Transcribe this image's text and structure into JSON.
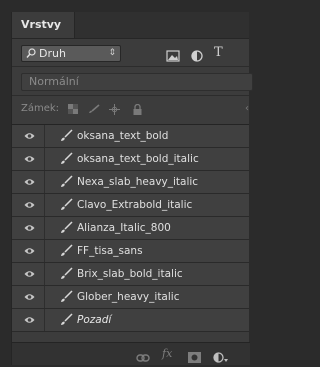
{
  "panel": {
    "tab_title": "Vrstvy",
    "filter": {
      "kind_label": "Druh",
      "icons": [
        "image-filter-icon",
        "adjustment-filter-icon",
        "type-filter-icon"
      ],
      "type_glyph": "T"
    },
    "blend_mode": "Normální",
    "lock_label": "Zámek:",
    "lock_icons": [
      "lock-transparency-icon",
      "lock-brush-icon",
      "lock-move-icon",
      "lock-all-icon"
    ],
    "layers": [
      {
        "name": "oksana_text_bold",
        "icon": "brush-icon"
      },
      {
        "name": "oksana_text_bold_italic",
        "icon": "brush-icon"
      },
      {
        "name": "Nexa_slab_heavy_italic",
        "icon": "brush-icon"
      },
      {
        "name": "Clavo_Extrabold_italic",
        "icon": "brush-icon"
      },
      {
        "name": "Alianza_Italic_800",
        "icon": "brush-icon"
      },
      {
        "name": "FF_tisa_sans",
        "icon": "brush-icon"
      },
      {
        "name": "Brix_slab_bold_italic",
        "icon": "brush-icon"
      },
      {
        "name": "Glober_heavy_italic",
        "icon": "brush-icon"
      },
      {
        "name": "Pozadí",
        "icon": "brush-icon"
      }
    ],
    "bottom_icons": [
      "link-layers-icon",
      "fx-icon",
      "layer-mask-icon",
      "adjustment-layer-icon"
    ],
    "fx_glyph": "fx"
  }
}
